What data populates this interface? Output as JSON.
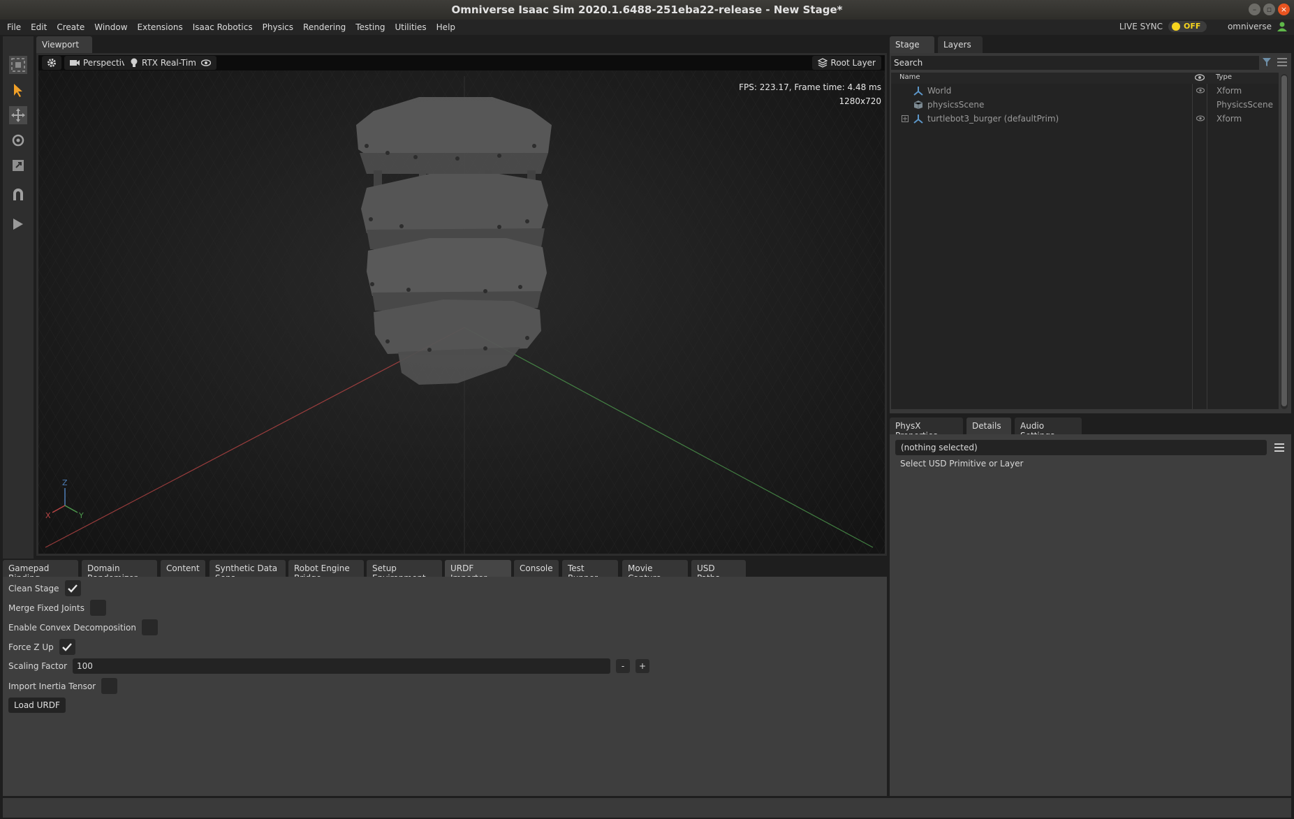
{
  "window": {
    "title": "Omniverse Isaac Sim 2020.1.6488-251eba22-release - New Stage*"
  },
  "menubar": {
    "items": [
      "File",
      "Edit",
      "Create",
      "Window",
      "Extensions",
      "Isaac Robotics",
      "Physics",
      "Rendering",
      "Testing",
      "Utilities",
      "Help"
    ],
    "live_sync_label": "LIVE SYNC",
    "live_sync_state": "OFF",
    "user": "omniverse"
  },
  "toolbar": {
    "icons": [
      "select-mode-icon",
      "select-arrow-icon",
      "move-icon",
      "rotate-icon",
      "scale-icon",
      "snap-magnet-icon",
      "play-icon"
    ]
  },
  "viewport": {
    "tab": "Viewport",
    "camera_label": "Perspective",
    "render_label": "RTX Real-Time",
    "layer_label": "Root Layer",
    "fps_text": "FPS: 223.17, Frame time: 4.48 ms",
    "resolution": "1280x720",
    "axis_labels": {
      "z": "Z",
      "x": "X",
      "y": "Y"
    }
  },
  "bottom_tabs": [
    "Gamepad Binding",
    "Domain Randomizer",
    "Content",
    "Synthetic Data Sens...",
    "Robot Engine Bridge",
    "Setup Environment...",
    "URDF Importer",
    "Console",
    "Test Runner",
    "Movie Capture",
    "USD Paths"
  ],
  "urdf": {
    "clean_stage_label": "Clean Stage",
    "clean_stage": true,
    "merge_fixed_joints_label": "Merge Fixed Joints",
    "merge_fixed_joints": false,
    "convex_decomp_label": "Enable Convex Decomposition",
    "convex_decomp": false,
    "force_z_up_label": "Force Z Up",
    "force_z_up": true,
    "scaling_factor_label": "Scaling Factor",
    "scaling_factor": "100",
    "minus_label": "-",
    "plus_label": "+",
    "import_inertia_label": "Import Inertia Tensor",
    "import_inertia": false,
    "load_button": "Load URDF"
  },
  "stage": {
    "tabs": [
      "Stage",
      "Layers"
    ],
    "search_placeholder": "Search",
    "col_name": "Name",
    "col_type": "Type",
    "rows": [
      {
        "name": "World",
        "type": "Xform"
      },
      {
        "name": "physicsScene",
        "type": "PhysicsScene"
      },
      {
        "name": "turtlebot3_burger (defaultPrim)",
        "type": "Xform"
      }
    ]
  },
  "props": {
    "tabs": [
      "PhysX Properties",
      "Details",
      "Audio Settings"
    ],
    "selection": "(nothing selected)",
    "hint": "Select USD Primitive or Layer"
  },
  "colors": {
    "accent": "#f7d51e",
    "x_axis": "#b94545",
    "y_axis": "#4d9a4d",
    "z_axis": "#4f7fb8",
    "xform_icon": "#5d97c9"
  }
}
